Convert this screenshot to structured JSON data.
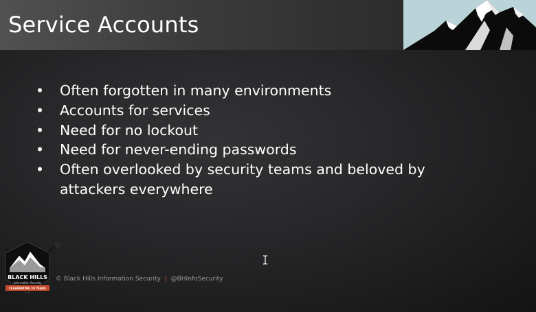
{
  "slide": {
    "title": "Service Accounts",
    "bullets": [
      "Often forgotten in many environments",
      "Accounts for services",
      "Need for no lockout",
      "Need for never-ending passwords",
      "Often overlooked by security teams and beloved by attackers everywhere"
    ],
    "bullet_symbol": "•"
  },
  "footer": {
    "copyright": "© Black Hills Information Security",
    "separator": "|",
    "handle": "@BHInfoSecurity"
  },
  "logo": {
    "line1": "BLACK HILLS",
    "line2": "Information Security",
    "banner": "CELEBRATING 10 YEARS"
  },
  "colors": {
    "title_bar": "#3c3c3d",
    "mountain_sky": "#b9d3d8",
    "accent": "#c94a2a",
    "text": "#ffffff"
  },
  "icons": [
    "mountain-peaks-icon",
    "bhis-logo-icon",
    "text-cursor-icon"
  ]
}
